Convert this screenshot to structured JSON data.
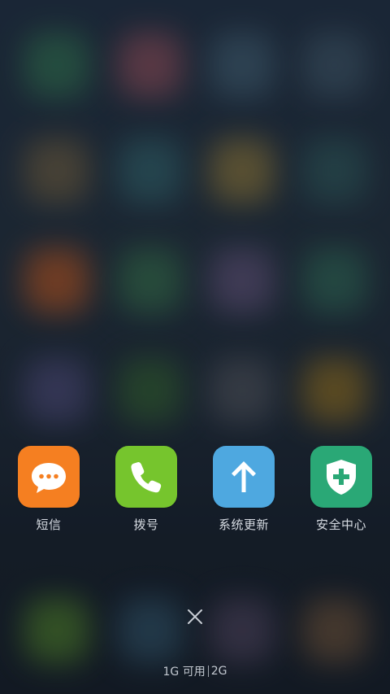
{
  "recent_apps": [
    {
      "label": "短信",
      "icon": "message-bubble-icon",
      "color": "#f57f21"
    },
    {
      "label": "拨号",
      "icon": "phone-handset-icon",
      "color": "#76c52d"
    },
    {
      "label": "系统更新",
      "icon": "arrow-up-icon",
      "color": "#4ea8e0"
    },
    {
      "label": "安全中心",
      "icon": "shield-plus-icon",
      "color": "#2aa876"
    }
  ],
  "close_icon": "close-icon",
  "memory": {
    "available": "1G 可用",
    "total": "2G"
  }
}
